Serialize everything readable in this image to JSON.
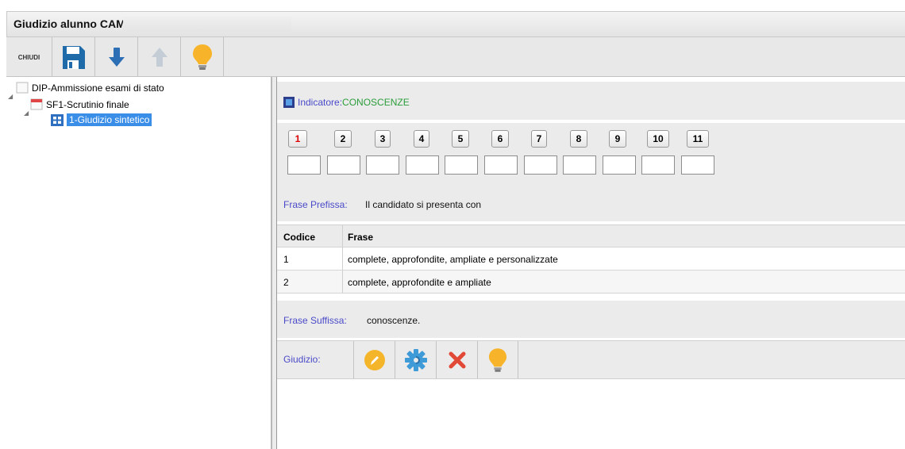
{
  "window": {
    "title": "Giudizio alunno CAMPANELLA PIERLUIGI"
  },
  "toolbar": {
    "close_label": "CHIUDI",
    "icons": [
      "save-icon",
      "arrow-down-icon",
      "arrow-up-icon",
      "lightbulb-icon"
    ]
  },
  "tree": {
    "items": [
      {
        "label": "DIP-Ammissione esami di stato",
        "level": 1
      },
      {
        "label": "SF1-Scrutinio finale",
        "level": 2
      },
      {
        "label": "1-Giudizio sintetico",
        "level": 3,
        "selected": true
      }
    ]
  },
  "indicator": {
    "label": "Indicatore:",
    "value": "CONOSCENZE"
  },
  "numbers": [
    "1",
    "2",
    "3",
    "4",
    "5",
    "6",
    "7",
    "8",
    "9",
    "10",
    "11"
  ],
  "prefix": {
    "label": "Frase Prefissa:",
    "text": "Il candidato si presenta con"
  },
  "table": {
    "headers": [
      "Codice",
      "Frase"
    ],
    "rows": [
      [
        "1",
        "complete, approfondite, ampliate e personalizzate"
      ],
      [
        "2",
        "complete, approfondite e ampliate"
      ]
    ]
  },
  "suffix": {
    "label": "Frase Suffissa:",
    "text": "conoscenze."
  },
  "giudizio": {
    "label": "Giudizio:",
    "icons": [
      "pencil-icon",
      "gear-icon",
      "delete-icon",
      "lightbulb-icon"
    ]
  },
  "colors": {
    "accent": "#4a4ac9",
    "indicator_value": "#2a9d3a",
    "selection": "#3b8ee8",
    "first_number": "#dd0000"
  }
}
